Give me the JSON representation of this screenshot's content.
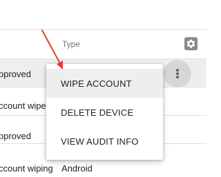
{
  "table": {
    "header": {
      "type_label": "Type",
      "settings_icon": "gear-icon"
    },
    "rows": [
      {
        "status": "pproved",
        "type": ""
      },
      {
        "status": "ccount wiped",
        "type": ""
      },
      {
        "status": "pproved",
        "type": ""
      },
      {
        "status": "ccount wiping",
        "type": "Android"
      }
    ]
  },
  "row_menu": {
    "icon": "more-vert-icon"
  },
  "menu": {
    "items": [
      {
        "label": "WIPE ACCOUNT"
      },
      {
        "label": "DELETE DEVICE"
      },
      {
        "label": "VIEW AUDIT INFO"
      }
    ]
  },
  "annotation": {
    "color": "#e53935"
  }
}
